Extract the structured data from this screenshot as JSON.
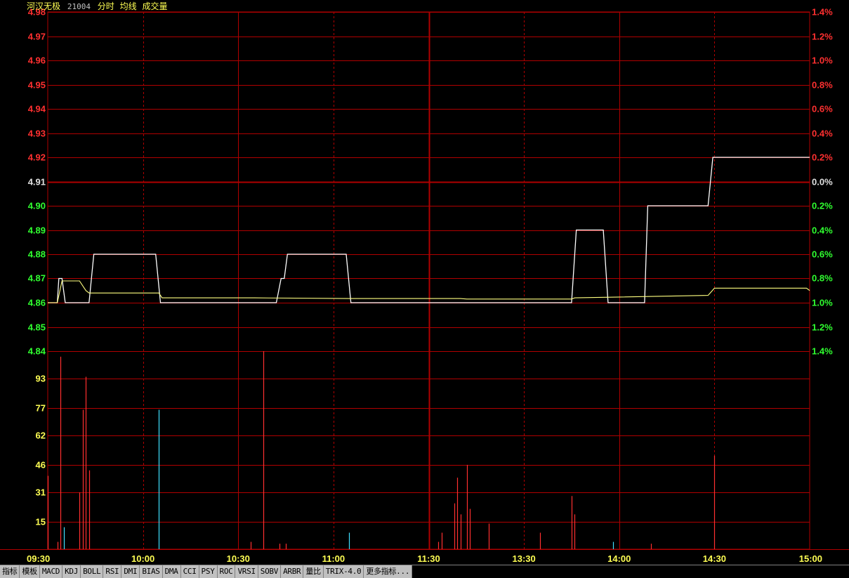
{
  "header": {
    "name": "河汉无极",
    "code": "21004",
    "indicators": [
      "分时",
      "均线",
      "成交量"
    ]
  },
  "colors": {
    "background": "#000000",
    "grid": "#b00000",
    "price_line": "#ffffff",
    "avg_line": "#ffff80",
    "up": "#ff3030",
    "down": "#30ff30",
    "flat": "#e0e0e0",
    "volume_up": "#ff3030",
    "volume_down": "#40e0ff",
    "volume_label": "#ffff54",
    "time_label": "#ffff54"
  },
  "tabs": [
    "指标",
    "模板",
    "MACD",
    "KDJ",
    "BOLL",
    "RSI",
    "DMI",
    "BIAS",
    "DMA",
    "CCI",
    "PSY",
    "ROC",
    "VRSI",
    "SOBV",
    "ARBR",
    "量比",
    "TRIX-4.0",
    "更多指标..."
  ],
  "chart_data": [
    {
      "type": "line",
      "name": "price-panel",
      "time_axis_labels": [
        "09:30",
        "10:00",
        "10:30",
        "11:00",
        "11:30",
        "13:30",
        "14:00",
        "14:30",
        "15:00"
      ],
      "y_left_ticks": [
        "4.98",
        "4.97",
        "4.96",
        "4.95",
        "4.94",
        "4.93",
        "4.92",
        "4.91",
        "4.90",
        "4.89",
        "4.88",
        "4.87",
        "4.86",
        "4.85",
        "4.84"
      ],
      "y_right_ticks": [
        "1.4%",
        "1.2%",
        "1.0%",
        "0.8%",
        "0.6%",
        "0.4%",
        "0.2%",
        "0.0%",
        "0.2%",
        "0.4%",
        "0.6%",
        "0.8%",
        "1.0%",
        "1.2%",
        "1.4%"
      ],
      "prev_close": 4.91,
      "ylim": [
        4.84,
        4.98
      ],
      "x_range_minutes": [
        0,
        240
      ],
      "series": [
        {
          "name": "分时",
          "color": "#ffffff",
          "points": [
            [
              0,
              4.86
            ],
            [
              3,
              4.86
            ],
            [
              3.5,
              4.87
            ],
            [
              4.5,
              4.87
            ],
            [
              5.5,
              4.86
            ],
            [
              13,
              4.86
            ],
            [
              14.5,
              4.88
            ],
            [
              34,
              4.88
            ],
            [
              35.5,
              4.86
            ],
            [
              72,
              4.86
            ],
            [
              73.5,
              4.87
            ],
            [
              74.5,
              4.87
            ],
            [
              75.5,
              4.88
            ],
            [
              94,
              4.88
            ],
            [
              95.5,
              4.86
            ],
            [
              165,
              4.86
            ],
            [
              166.5,
              4.89
            ],
            [
              175,
              4.89
            ],
            [
              176.5,
              4.86
            ],
            [
              188,
              4.86
            ],
            [
              189,
              4.9
            ],
            [
              208,
              4.9
            ],
            [
              209.5,
              4.92
            ],
            [
              240,
              4.92
            ]
          ]
        },
        {
          "name": "均线",
          "color": "#ffff80",
          "points": [
            [
              0,
              4.86
            ],
            [
              3,
              4.86
            ],
            [
              4.5,
              4.869
            ],
            [
              10,
              4.869
            ],
            [
              12,
              4.865
            ],
            [
              13,
              4.864
            ],
            [
              35,
              4.864
            ],
            [
              36,
              4.862
            ],
            [
              65,
              4.862
            ],
            [
              95,
              4.8617
            ],
            [
              130,
              4.8617
            ],
            [
              132,
              4.8615
            ],
            [
              165,
              4.8615
            ],
            [
              166,
              4.862
            ],
            [
              208,
              4.863
            ],
            [
              210,
              4.866
            ],
            [
              239,
              4.866
            ],
            [
              240,
              4.865
            ]
          ]
        }
      ]
    },
    {
      "type": "bar",
      "name": "volume-panel",
      "series_name": "成交量",
      "y_ticks": [
        "93",
        "77",
        "62",
        "46",
        "31",
        "15"
      ],
      "ylim": [
        0,
        108
      ],
      "bars": [
        [
          0,
          40,
          "up"
        ],
        [
          3,
          4,
          "up"
        ],
        [
          4,
          105,
          "up"
        ],
        [
          5,
          12,
          "down"
        ],
        [
          10,
          31,
          "up"
        ],
        [
          11,
          76,
          "up"
        ],
        [
          12,
          94,
          "up"
        ],
        [
          13,
          43,
          "up"
        ],
        [
          35,
          76,
          "down"
        ],
        [
          64,
          4,
          "up"
        ],
        [
          68,
          108,
          "up"
        ],
        [
          73,
          3,
          "up"
        ],
        [
          75,
          3,
          "up"
        ],
        [
          95,
          9,
          "down"
        ],
        [
          123,
          4,
          "up"
        ],
        [
          124,
          9,
          "up"
        ],
        [
          128,
          25,
          "up"
        ],
        [
          129,
          39,
          "up"
        ],
        [
          130,
          19,
          "up"
        ],
        [
          132,
          46,
          "up"
        ],
        [
          133,
          22,
          "up"
        ],
        [
          139,
          14,
          "up"
        ],
        [
          155,
          9,
          "up"
        ],
        [
          165,
          29,
          "up"
        ],
        [
          166,
          19,
          "up"
        ],
        [
          178,
          4,
          "down"
        ],
        [
          190,
          3,
          "up"
        ],
        [
          210,
          51,
          "up"
        ]
      ]
    }
  ]
}
